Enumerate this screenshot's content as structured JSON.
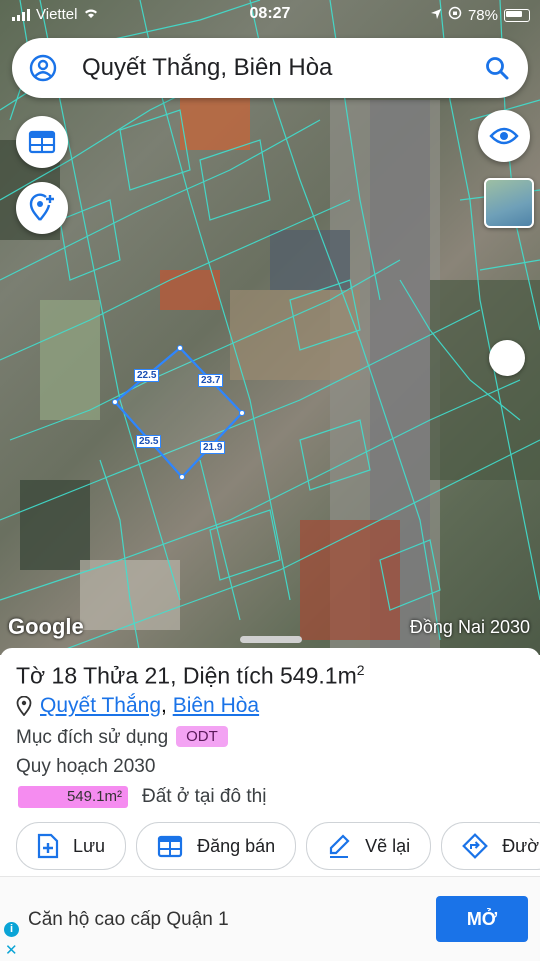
{
  "status_bar": {
    "carrier": "Viettel",
    "time": "08:27",
    "battery": "78%"
  },
  "search": {
    "query": "Quyết Thắng, Biên Hòa"
  },
  "map": {
    "segments": [
      {
        "label": "22.5"
      },
      {
        "label": "23.7"
      },
      {
        "label": "25.5"
      },
      {
        "label": "21.9"
      }
    ],
    "watermark": "Google",
    "plan_label": "Đồng Nai 2030"
  },
  "parcel": {
    "title_prefix": "Tờ 18 Thửa 21, Diện tích 549.1m",
    "title_sup": "2",
    "address": {
      "ward": "Quyết Thắng",
      "separator": ", ",
      "city": "Biên Hòa"
    },
    "usage_label": "Mục đích sử dụng",
    "usage_code": "ODT",
    "plan_title": "Quy hoạch 2030",
    "plan_area": "549.1m²",
    "plan_desc": "Đất ở tại đô thị"
  },
  "actions": [
    {
      "label": "Lưu",
      "icon": "save-icon"
    },
    {
      "label": "Đăng bán",
      "icon": "calendar-icon"
    },
    {
      "label": "Vẽ lại",
      "icon": "edit-icon"
    },
    {
      "label": "Đườ",
      "icon": "directions-icon"
    }
  ],
  "ad": {
    "text": "Căn hộ cao cấp Quận 1",
    "cta": "MỞ"
  },
  "colors": {
    "accent": "#1a73e8",
    "parcel_line": "#40e0d0",
    "plan_badge": "#f3a3f3"
  }
}
